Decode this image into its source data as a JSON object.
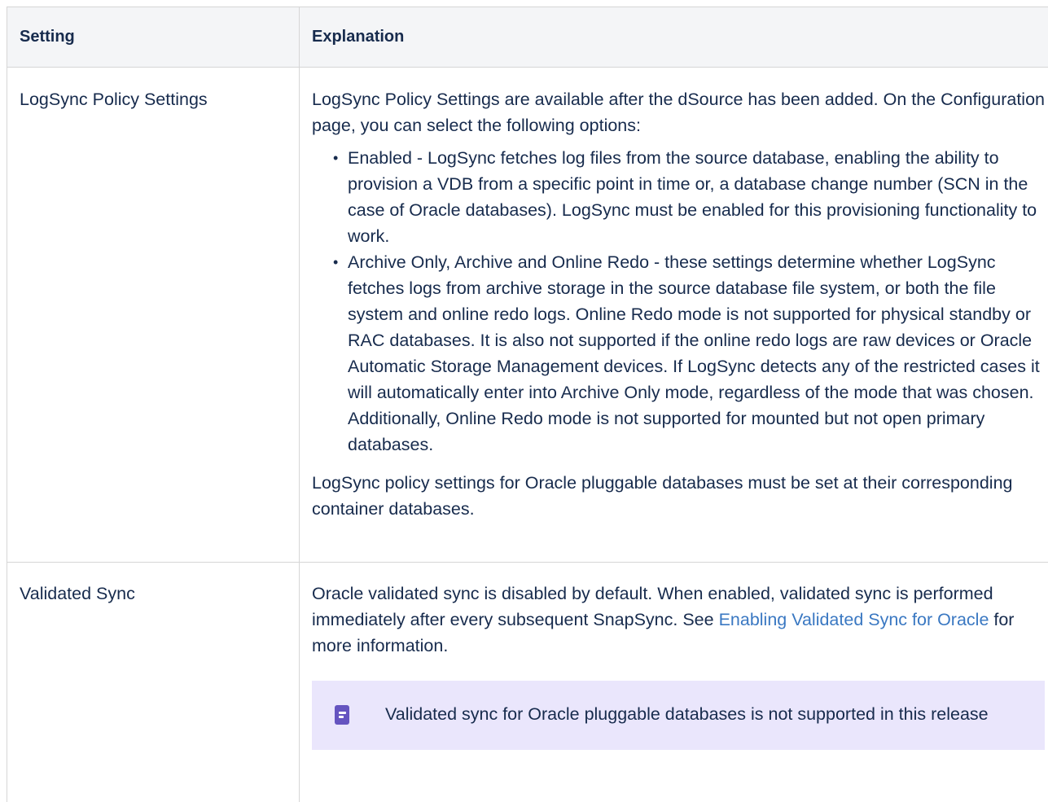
{
  "table": {
    "headers": {
      "setting": "Setting",
      "explanation": "Explanation"
    },
    "rows": [
      {
        "setting": "LogSync Policy Settings",
        "intro": "LogSync Policy Settings are available after the dSource has been added. On the Configuration page, you can select the following options:",
        "bullets": [
          "Enabled - LogSync fetches log files from the source database, enabling the ability to provision a VDB from a specific point in time or, a database change number (SCN in the case of Oracle databases). LogSync must be enabled for this provisioning functionality to work.",
          "Archive Only, Archive and Online Redo - these settings determine whether LogSync fetches logs from archive storage in the source database file system, or both the file system and online redo logs. Online Redo mode is not supported for physical standby or RAC databases. It is also not supported if the online redo logs are raw devices or Oracle Automatic Storage Management devices. If LogSync detects any of the restricted cases it will automatically enter into Archive Only mode, regardless of the mode that was chosen. Additionally, Online Redo mode is not supported for mounted but not open primary databases."
        ],
        "outro": "LogSync policy settings for Oracle pluggable databases must be set at their corresponding container databases."
      },
      {
        "setting": "Validated Sync",
        "text_before_link": "Oracle validated sync is disabled by default. When enabled, validated sync is performed immediately after every subsequent SnapSync. See ",
        "link_text": "Enabling Validated Sync for Oracle",
        "text_after_link": " for more information.",
        "note": {
          "icon": "note-icon",
          "text": "Validated sync for Oracle pluggable databases is not supported in this release"
        }
      }
    ]
  }
}
